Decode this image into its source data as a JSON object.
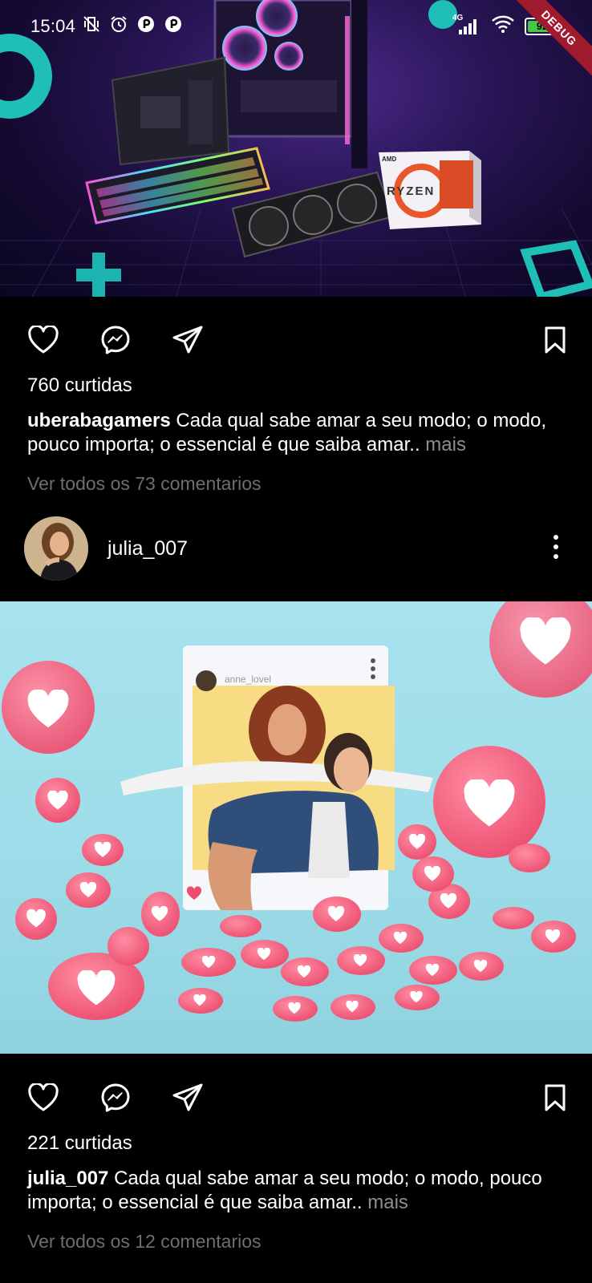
{
  "status_bar": {
    "time": "15:04",
    "network": "4G",
    "battery": "92",
    "battery_level": 0.92,
    "debug_label": "DEBUG"
  },
  "posts": [
    {
      "likes": "760 curtidas",
      "username": "uberabagamers",
      "caption": "Cada qual sabe amar a seu modo; o modo, pouco importa; o essencial é que saiba amar..",
      "more": "mais",
      "comments": "Ver todos os 73 comentarios",
      "image_texts": {
        "brand": "RYZEN",
        "vendor": "AMD"
      }
    },
    {
      "header_username": "julia_007",
      "likes": "221 curtidas",
      "username": "julia_007",
      "caption": "Cada qual sabe amar a seu modo; o modo, pouco importa; o essencial é que saiba amar..",
      "more": "mais",
      "comments": "Ver todos os 12 comentarios",
      "image_texts": {
        "frame_user": "anne_lovel"
      }
    }
  ],
  "icons": {
    "like": "heart-icon",
    "comment": "messenger-icon",
    "share": "send-icon",
    "save": "bookmark-icon",
    "options": "more-vertical-icon"
  },
  "colors": {
    "background": "#000000",
    "text": "#ffffff",
    "muted": "#8e8e8e",
    "battery": "#43c848",
    "debug_ribbon": "#a11b2f",
    "heart_pink": "#f4607e"
  }
}
